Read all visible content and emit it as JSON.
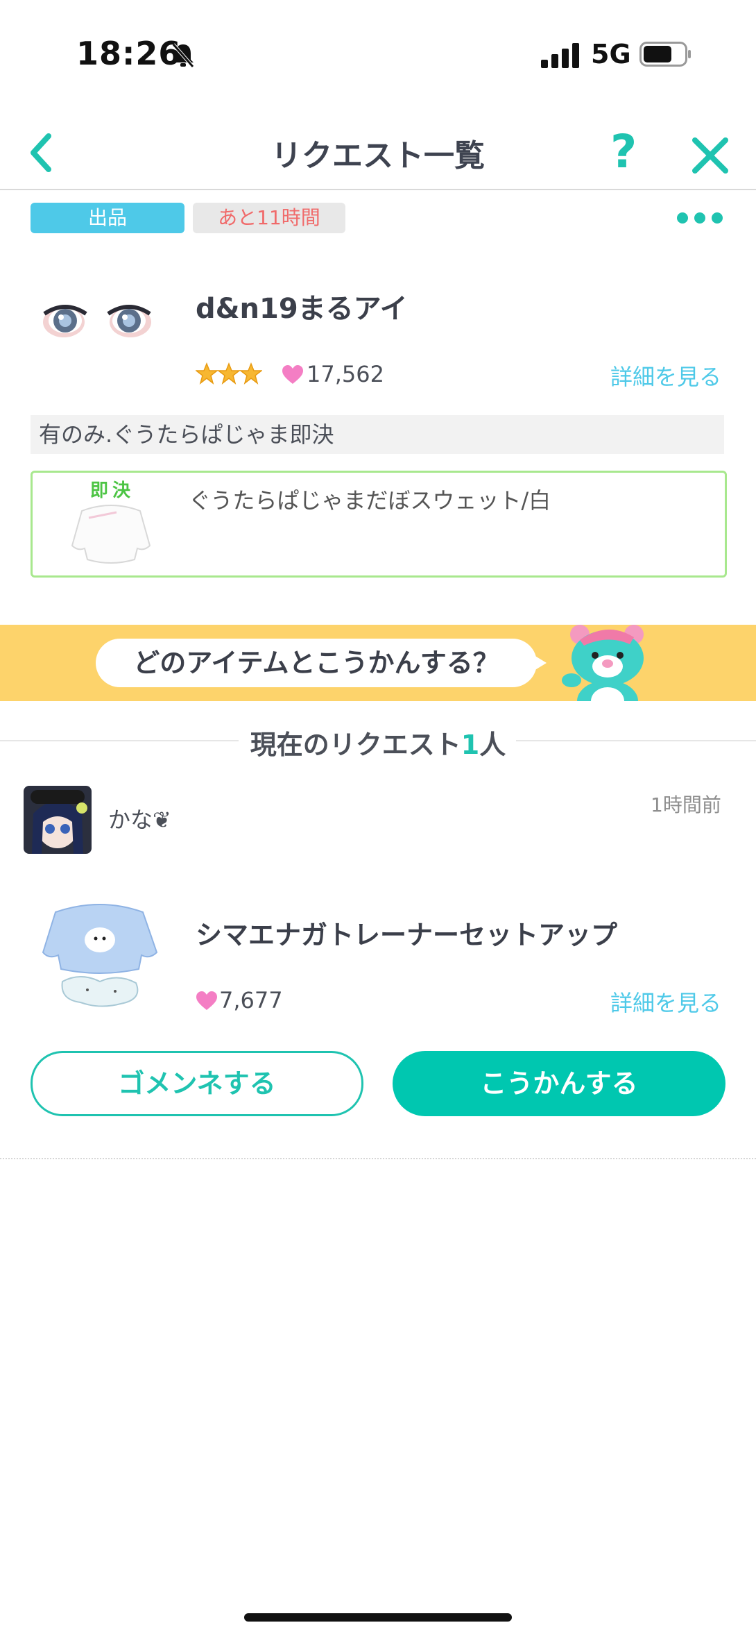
{
  "status_bar": {
    "time": "18:26",
    "network": "5G"
  },
  "nav": {
    "title": "リクエスト一覧",
    "help": "?"
  },
  "listing": {
    "badge_sale": "出品",
    "badge_time": "あと11時間",
    "item_name": "d&n19まるアイ",
    "likes": "17,562",
    "details_link": "詳細を見る",
    "note": "有のみ.ぐうたらぱじゃま即決",
    "instant_label": "即決",
    "wanted_item": "ぐうたらぱじゃまだぼスウェット/白"
  },
  "banner": {
    "prompt": "どのアイテムとこうかんする？"
  },
  "requests": {
    "title_prefix": "現在のリクエスト",
    "count": "1",
    "title_suffix": "人"
  },
  "request": {
    "user_name": "かな❦",
    "time_ago": "1時間前",
    "offer_name": "シマエナガトレーナーセットアップ",
    "offer_likes": "7,677",
    "details_link": "詳細を見る",
    "decline_label": "ゴメンネする",
    "accept_label": "こうかんする"
  },
  "colors": {
    "accent": "#1fc3b0",
    "link": "#4ec9e8",
    "banner": "#fdd36b",
    "heart": "#f47ec4"
  }
}
